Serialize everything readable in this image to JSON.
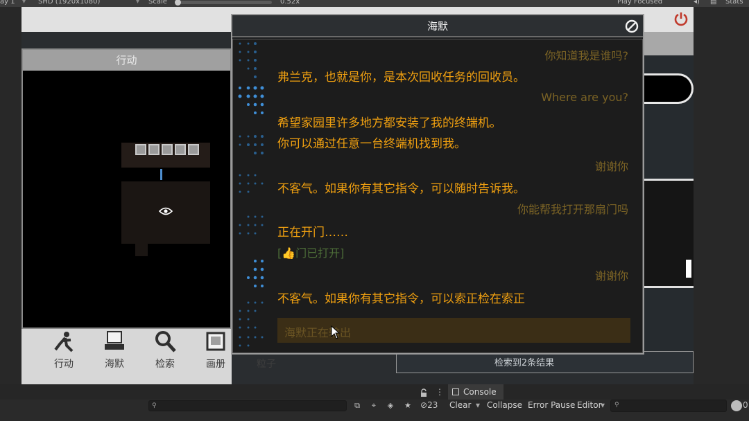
{
  "toolbar": {
    "play_mode": "ay 1",
    "resolution": "SHD (1920x1080)",
    "scale_label": "Scale",
    "scale_value": "0.52x",
    "play_focused": "Play Focused",
    "stats": "Stats"
  },
  "game": {
    "action_panel_title": "行动",
    "tools": [
      "行动",
      "海默",
      "检索",
      "画册",
      "粒子"
    ],
    "search_result": "检索到2条结果"
  },
  "dialog": {
    "title": "海默",
    "messages": [
      {
        "role": "user",
        "text": "你知道我是谁吗?"
      },
      {
        "role": "bot",
        "text": "弗兰克，也就是你，是本次回收任务的回收员。"
      },
      {
        "role": "user",
        "text": "Where are you?"
      },
      {
        "role": "bot",
        "text": "希望家园里许多地方都安装了我的终端机。"
      },
      {
        "role": "bot",
        "text": "你可以通过任意一台终端机找到我。"
      },
      {
        "role": "user",
        "text": "谢谢你"
      },
      {
        "role": "bot",
        "text": "不客气。如果你有其它指令，可以随时告诉我。"
      },
      {
        "role": "user",
        "text": "你能帮我打开那扇门吗"
      },
      {
        "role": "bot",
        "text": "正在开门……"
      },
      {
        "role": "sys",
        "text": "[👍门已打开]"
      },
      {
        "role": "user",
        "text": "谢谢你"
      },
      {
        "role": "bot",
        "text": "不客气。如果你有其它指令，可以索正检在索正"
      }
    ],
    "input_hint": "海默正在输出"
  },
  "bottom": {
    "hidden_count": "23",
    "console_tab": "Console",
    "console_buttons": {
      "clear": "Clear",
      "collapse": "Collapse",
      "error_pause": "Error Pause",
      "editor": "Editor"
    },
    "info_count": "0"
  },
  "colors": {
    "accent_orange": "#f0a010",
    "user_text": "#7b6325",
    "system_green": "#4d6d38",
    "power_red": "#c0392b"
  }
}
